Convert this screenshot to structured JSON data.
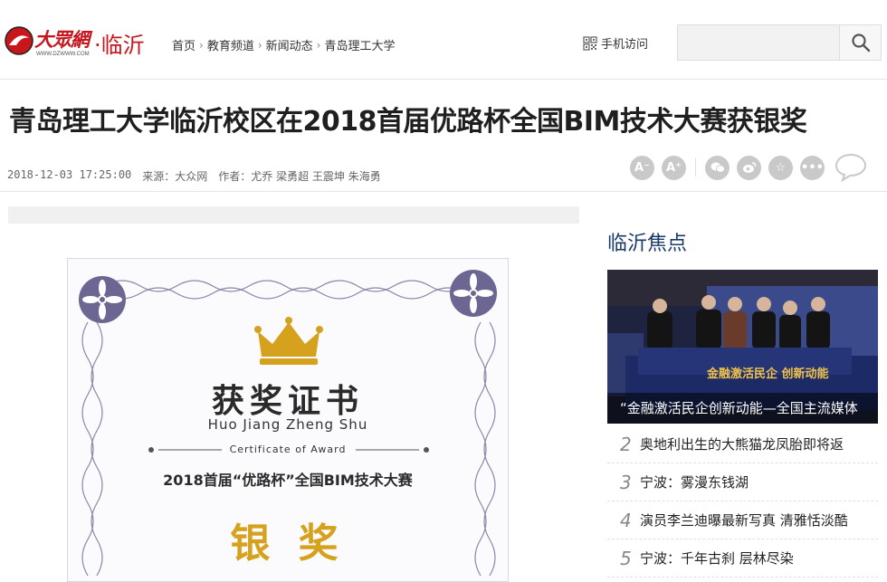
{
  "header": {
    "logo_text": "大眾網",
    "logo_url": "WWW.DZWWW.COM",
    "city": "·临沂",
    "breadcrumb": [
      "首页",
      "教育频道",
      "新闻动态",
      "青岛理工大学"
    ],
    "mobile_label": "手机访问",
    "search_placeholder": ""
  },
  "article": {
    "title": "青岛理工大学临沂校区在2018首届优路杯全国BIM技术大赛获银奖",
    "datetime": "2018-12-03 17:25:00",
    "source": "来源：大众网",
    "authors": "作者：尤乔 梁勇超 王震坤 朱海勇",
    "tools": [
      {
        "name": "font-decrease-icon",
        "glyph": "A⁻"
      },
      {
        "name": "font-increase-icon",
        "glyph": "A⁺"
      },
      {
        "name": "wechat-icon",
        "glyph": "◉"
      },
      {
        "name": "weibo-icon",
        "glyph": "◎"
      },
      {
        "name": "favorite-icon",
        "glyph": "☆"
      },
      {
        "name": "more-icon",
        "glyph": "•••"
      }
    ]
  },
  "certificate": {
    "title_cn": "获奖证书",
    "title_pinyin": "Huo Jiang Zheng Shu",
    "subtitle": "Certificate of Award",
    "event": "2018首届“优路杯”全国BIM技术大赛",
    "award": "银 奖"
  },
  "sidebar": {
    "title": "临沂焦点",
    "feature_caption": "“金融激活民企创新动能—全国主流媒体",
    "feature_banner": "金融激活民企 创新动能",
    "news": [
      {
        "num": "2",
        "text": "奥地利出生的大熊猫龙凤胎即将返"
      },
      {
        "num": "3",
        "text": "宁波：雾漫东钱湖"
      },
      {
        "num": "4",
        "text": "演员李兰迪曝最新写真 清雅恬淡酷"
      },
      {
        "num": "5",
        "text": "宁波：千年古刹 层林尽染"
      }
    ]
  },
  "colors": {
    "brand_red": "#c8161d",
    "sidebar_title": "#1a3a6a",
    "cert_gold": "#d6a21e"
  }
}
